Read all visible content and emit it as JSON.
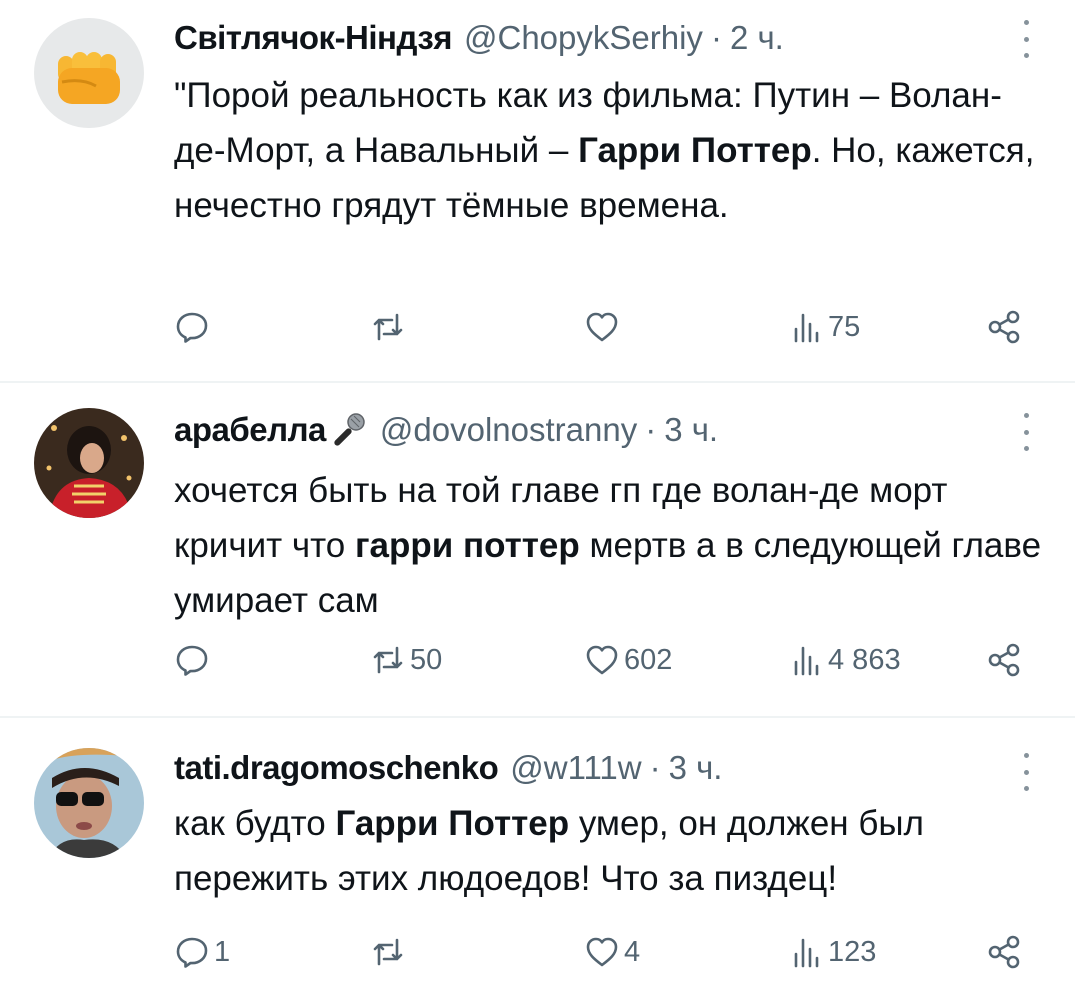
{
  "tweets": [
    {
      "display_name": "Світлячок-Ніндзя",
      "handle": "@ChopykSerhiy",
      "separator": "·",
      "time": "2 ч.",
      "avatar_icon": "raised-fist-emoji",
      "text_1": "\"Порой реальность как из фильма: Путин – Волан-де-Морт, а Навальный – ",
      "text_bold": "Гарри Поттер",
      "text_2": ". Но, кажется, нечестно грядут тёмные времена.",
      "replies": "",
      "retweets": "",
      "likes": "",
      "views": "75"
    },
    {
      "display_name": "арабелла",
      "handle": "@dovolnostranny",
      "separator": "·",
      "time": "3 ч.",
      "avatar_icon": "costume-portrait-avatar",
      "name_icon": "microphone-emoji",
      "text_1": "хочется быть на той главе гп где волан-де морт кричит что ",
      "text_bold": "гарри поттер",
      "text_2": " мертв а в следующей главе умирает сам",
      "replies": "",
      "retweets": "50",
      "likes": "602",
      "views": "4 863"
    },
    {
      "display_name": "tati.dragomoschenko",
      "handle": "@w111w",
      "separator": "·",
      "time": "3 ч.",
      "avatar_icon": "sunglasses-portrait-avatar",
      "text_1": "как будто ",
      "text_bold": "Гарри Поттер",
      "text_2": " умер, он должен был пережить этих людоедов! Что за пиздец!",
      "replies": "1",
      "retweets": "",
      "likes": "4",
      "views": "123"
    }
  ],
  "colors": {
    "text": "#0f1419",
    "secondary": "#536471",
    "divider": "#eff3f4",
    "avatar_bg": "#e7e9ea"
  }
}
